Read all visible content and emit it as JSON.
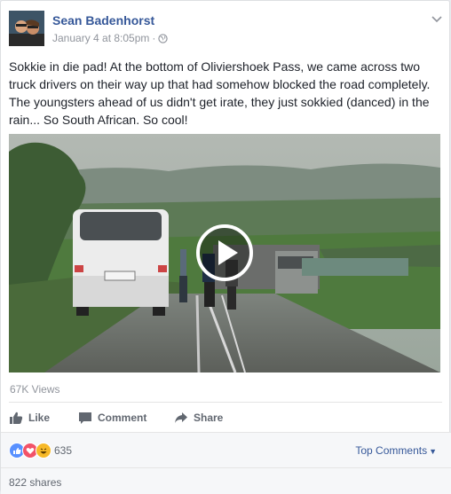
{
  "post": {
    "author": "Sean Badenhorst",
    "timestamp": "January 4 at 8:05pm",
    "separator": "·",
    "privacy_icon": "globe-icon",
    "menu_icon": "chevron-down-icon",
    "text": "Sokkie in die pad! At the bottom of Oliviershoek Pass, we came across two truck drivers on their way up that had somehow blocked the road completely. The youngsters ahead of us didn't get irate, they just sokkied (danced) in the rain... So South African. So cool!"
  },
  "video": {
    "play_icon": "play-icon",
    "views": "67K Views"
  },
  "actions": {
    "like": "Like",
    "comment": "Comment",
    "share": "Share"
  },
  "reactions": {
    "icons": [
      "like-reaction-icon",
      "love-reaction-icon",
      "haha-reaction-icon"
    ],
    "count": "635",
    "sort_label": "Top Comments",
    "colors": {
      "like": "#5890ff",
      "love": "#f25268",
      "haha": "#f7b928"
    }
  },
  "shares": {
    "label": "822 shares"
  },
  "colors": {
    "link": "#365899",
    "meta": "#90949c",
    "action": "#616770"
  }
}
